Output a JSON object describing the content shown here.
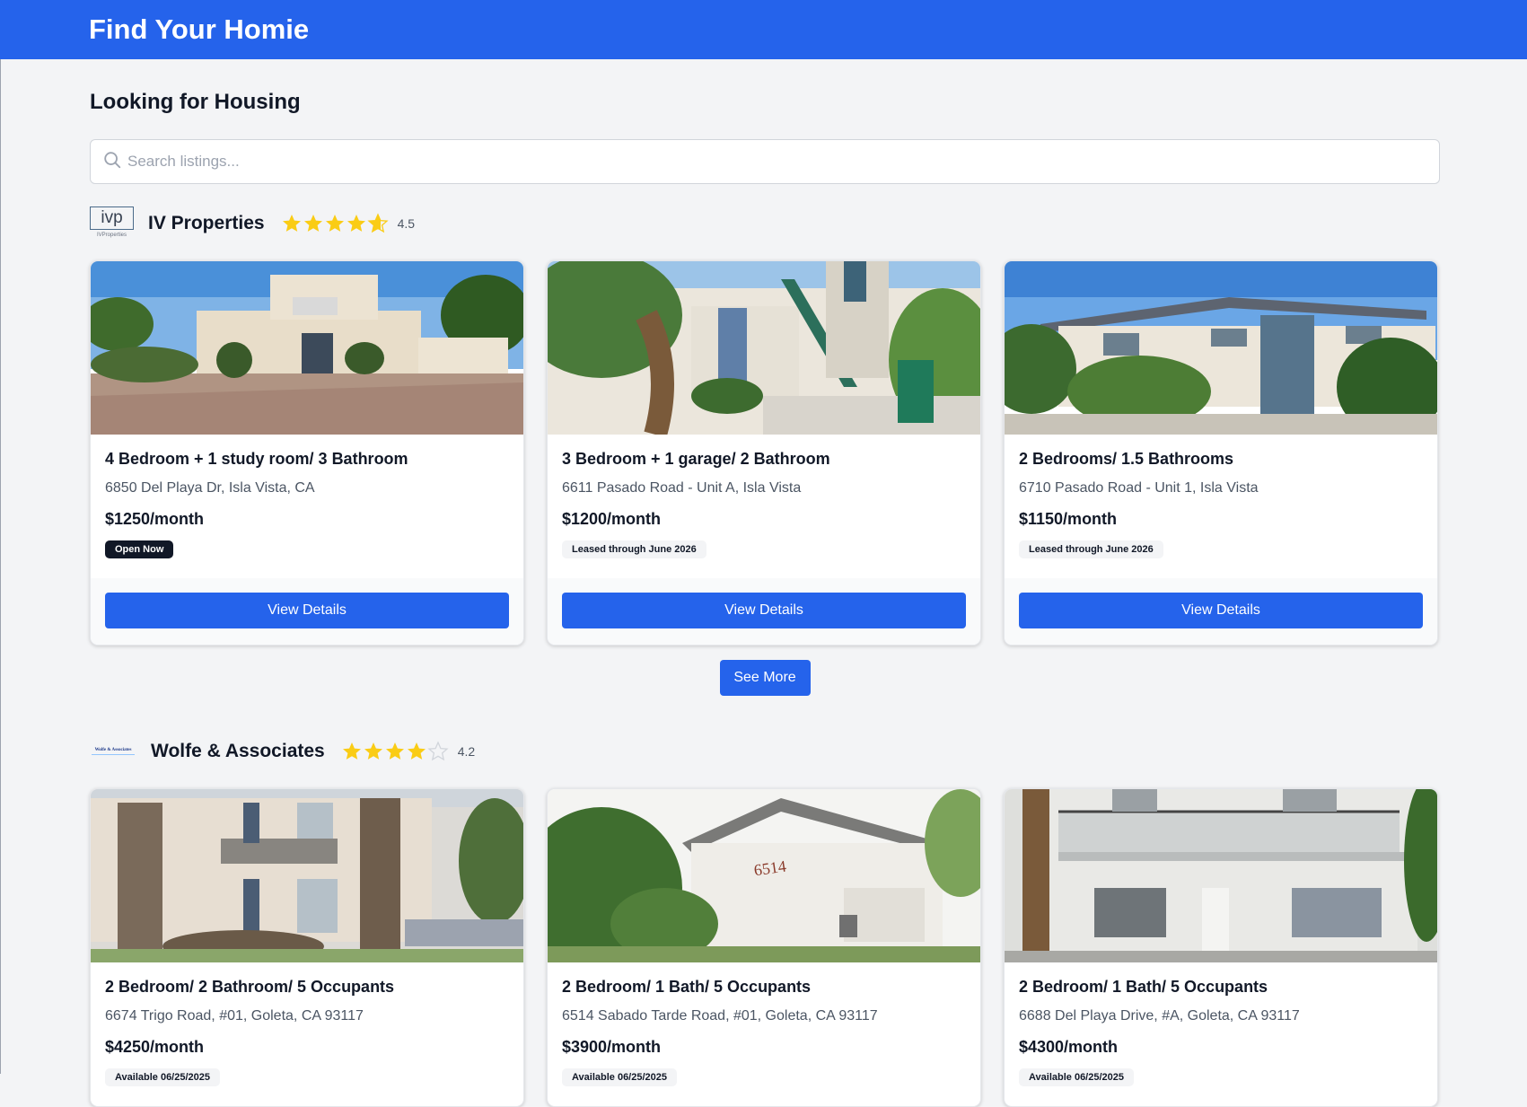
{
  "app": {
    "brand": "Find Your Homie"
  },
  "page": {
    "title": "Looking for Housing"
  },
  "search": {
    "placeholder": "Search listings..."
  },
  "colors": {
    "accent": "#2563eb",
    "star": "#facc15",
    "background": "#f3f4f6"
  },
  "companies": [
    {
      "name": "IV Properties",
      "logo_text": "ivp",
      "logo_subtext": "IVProperties",
      "rating": 4.5,
      "rating_label": "4.5",
      "see_more_label": "See More",
      "listings": [
        {
          "title": "4 Bedroom + 1 study room/ 3 Bathroom",
          "address": "6850 Del Playa Dr, Isla Vista, CA",
          "price": "$1250/month",
          "badge": "Open Now",
          "button": "View Details"
        },
        {
          "title": "3 Bedroom + 1 garage/ 2 Bathroom",
          "address": "6611 Pasado Road - Unit A, Isla Vista",
          "price": "$1200/month",
          "badge": "Leased through June 2026",
          "button": "View Details"
        },
        {
          "title": "2 Bedrooms/ 1.5 Bathrooms",
          "address": "6710 Pasado Road - Unit 1, Isla Vista",
          "price": "$1150/month",
          "badge": "Leased through June 2026",
          "button": "View Details"
        }
      ]
    },
    {
      "name": "Wolfe & Associates",
      "logo_text": "Wolfe & Associates",
      "rating": 4.2,
      "rating_label": "4.2",
      "listings": [
        {
          "title": "2 Bedroom/ 2 Bathroom/ 5 Occupants",
          "address": "6674 Trigo Road, #01, Goleta, CA 93117",
          "price": "$4250/month",
          "badge": "Available 06/25/2025"
        },
        {
          "title": "2 Bedroom/ 1 Bath/ 5 Occupants",
          "address": "6514 Sabado Tarde Road, #01, Goleta, CA 93117",
          "price": "$3900/month",
          "badge": "Available 06/25/2025",
          "photo_sign": "6514"
        },
        {
          "title": "2 Bedroom/ 1 Bath/ 5 Occupants",
          "address": "6688 Del Playa Drive, #A, Goleta, CA 93117",
          "price": "$4300/month",
          "badge": "Available 06/25/2025"
        }
      ]
    }
  ]
}
